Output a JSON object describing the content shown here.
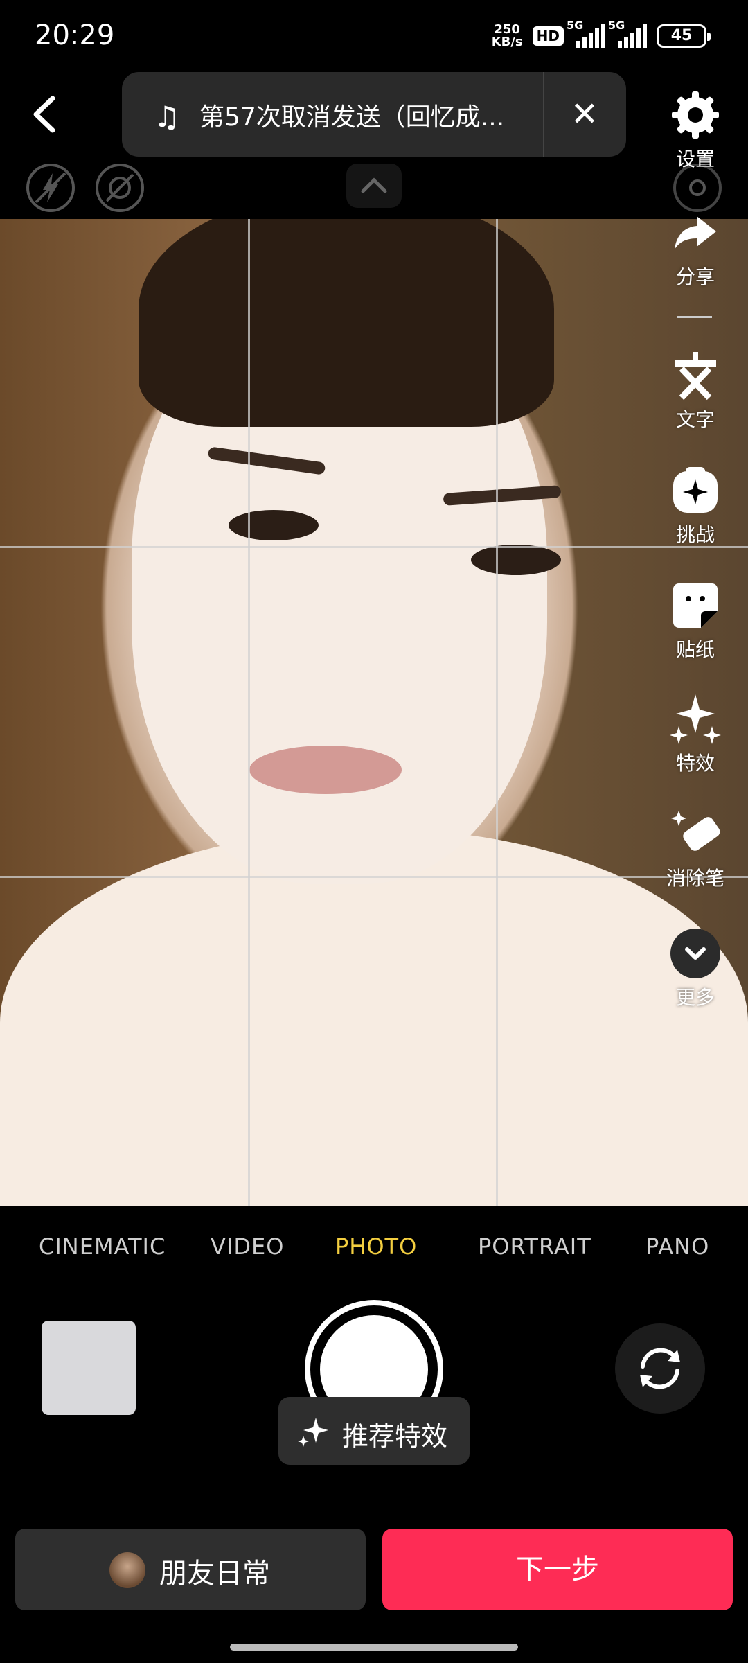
{
  "status_bar": {
    "time": "20:29",
    "net_speed_value": "250",
    "net_speed_unit": "KB/s",
    "hd_badge": "HD",
    "signal1_label": "5G",
    "signal2_label": "5G",
    "battery": "45"
  },
  "music": {
    "title": "第57次取消发送（回忆成..."
  },
  "toolbar": {
    "settings": "设置",
    "share": "分享",
    "text": "文字",
    "challenge": "挑战",
    "sticker": "贴纸",
    "effects": "特效",
    "eraser": "消除笔",
    "more": "更多"
  },
  "modes": [
    "CINEMATIC",
    "VIDEO",
    "PHOTO",
    "PORTRAIT",
    "PANO"
  ],
  "active_mode": "PHOTO",
  "recommend_effects": "推荐特效",
  "bottom": {
    "friend_daily": "朋友日常",
    "next_step": "下一步"
  },
  "colors": {
    "accent": "#fe2c55",
    "active_mode": "#f4cf40",
    "pill_bg": "#2a2a2a"
  }
}
